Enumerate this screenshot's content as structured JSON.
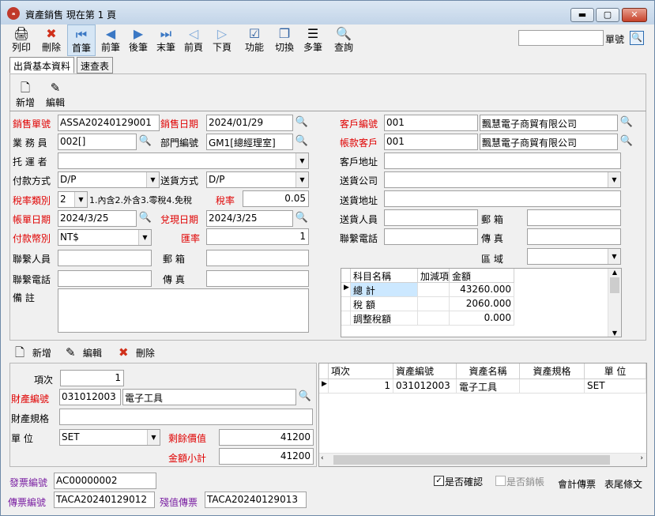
{
  "window": {
    "title": "資產銷售  現在第 1 頁",
    "app_icon_text": "ₐ",
    "min": "▬",
    "max": "▢",
    "close": "✕"
  },
  "toolbar": [
    {
      "label": "列印",
      "icon": "printer-icon",
      "glyph": "🖨"
    },
    {
      "label": "刪除",
      "icon": "delete-icon",
      "glyph": "✖"
    },
    {
      "label": "首筆",
      "icon": "first-record-icon",
      "glyph": "⏮"
    },
    {
      "label": "前筆",
      "icon": "prev-record-icon",
      "glyph": "◀"
    },
    {
      "label": "後筆",
      "icon": "next-record-icon",
      "glyph": "▶"
    },
    {
      "label": "末筆",
      "icon": "last-record-icon",
      "glyph": "⏭"
    },
    {
      "label": "前頁",
      "icon": "prev-page-icon",
      "glyph": "◁"
    },
    {
      "label": "下頁",
      "icon": "next-page-icon",
      "glyph": "▷"
    },
    {
      "label": "功能",
      "icon": "function-icon",
      "glyph": "☑"
    },
    {
      "label": "切換",
      "icon": "switch-icon",
      "glyph": "❐"
    },
    {
      "label": "多筆",
      "icon": "multi-record-icon",
      "glyph": "☰"
    },
    {
      "label": "查詢",
      "icon": "query-icon",
      "glyph": "🔍"
    }
  ],
  "search": {
    "label": "單號",
    "value": ""
  },
  "tabs": [
    {
      "label": "出貨基本資料"
    },
    {
      "label": "速查表"
    }
  ],
  "header_actions": {
    "add": "新增",
    "edit": "編輯"
  },
  "form": {
    "sale_no_label": "銷售單號",
    "sale_no": "ASSA20240129001",
    "sale_date_label": "銷售日期",
    "sale_date": "2024/01/29",
    "salesman_label": "業 務 員",
    "salesman": "002[]",
    "dept_label": "部門編號",
    "dept": "GM1[總經理室]",
    "carrier_label": "托 運 者",
    "carrier": "",
    "pay_method_label": "付款方式",
    "pay_method": "D/P",
    "ship_method_label": "送貨方式",
    "ship_method": "D/P",
    "tax_type_label": "稅率類別",
    "tax_type": "2",
    "tax_type_desc": "1.內含2.外含3.零稅4.免稅",
    "tax_rate_label": "稅率",
    "tax_rate": "0.05",
    "bill_date_label": "帳單日期",
    "bill_date": "2024/3/25",
    "cash_date_label": "兌現日期",
    "cash_date": "2024/3/25",
    "currency_label": "付款幣別",
    "currency": "NT$",
    "exchange_label": "匯率",
    "exchange": "1",
    "contact_label": "聯繫人員",
    "contact": "",
    "zip_label": "郵      箱",
    "zip": "",
    "phone_label": "聯繫電話",
    "phone": "",
    "fax_label": "傳      真",
    "fax": "",
    "note_label": "備      註",
    "note": ""
  },
  "customer": {
    "code_label": "客戶編號",
    "code": "001",
    "name": "飄慧電子商貿有限公司",
    "account_label": "帳款客戶",
    "account": "001",
    "account_name": "飄慧電子商貿有限公司",
    "address_label": "客戶地址",
    "address": "",
    "ship_co_label": "送貨公司",
    "ship_co": "",
    "ship_addr_label": "送貨地址",
    "ship_addr": "",
    "ship_person_label": "送貨人員",
    "ship_person": "",
    "zip_label": "郵      箱",
    "zip": "",
    "phone_label": "聯繫電話",
    "phone": "",
    "fax_label": "傳      真",
    "fax": "",
    "region_label": "區      域",
    "region": ""
  },
  "summary": {
    "headers": [
      "科目名稱",
      "加減項",
      "金額"
    ],
    "rows": [
      {
        "name": "總      計",
        "sign": "",
        "amount": "43260.000"
      },
      {
        "name": "稅      額",
        "sign": "",
        "amount": "2060.000"
      },
      {
        "name": "調整稅額",
        "sign": "",
        "amount": "0.000"
      }
    ]
  },
  "detail_actions": {
    "add": "新增",
    "edit": "編輯",
    "delete": "刪除"
  },
  "detail": {
    "item_label": "項次",
    "item": "1",
    "asset_no_label": "財產編號",
    "asset_no": "031012003",
    "asset_name": "電子工具",
    "spec_label": "財產規格",
    "spec": "",
    "unit_label": "單      位",
    "unit": "SET",
    "residual_label": "剩餘價值",
    "residual": "41200",
    "subtotal_label": "金額小計",
    "subtotal": "41200"
  },
  "detail_grid": {
    "headers": [
      "項次",
      "資產編號",
      "資產名稱",
      "資產規格",
      "單      位"
    ],
    "rows": [
      {
        "item": "1",
        "asset_no": "031012003",
        "asset_name": "電子工具",
        "spec": "",
        "unit": "SET"
      }
    ]
  },
  "footer": {
    "invoice_label": "發票編號",
    "invoice": "AC00000002",
    "voucher_label": "傳票編號",
    "voucher": "TACA20240129012",
    "residual_voucher_label": "殘值傳票",
    "residual_voucher": "TACA20240129013",
    "confirmed_label": "是否確認",
    "confirmed": true,
    "writeoff_label": "是否銷帳",
    "writeoff": false,
    "accounting_voucher": "會計傳票",
    "footer_text": "表尾條文"
  }
}
